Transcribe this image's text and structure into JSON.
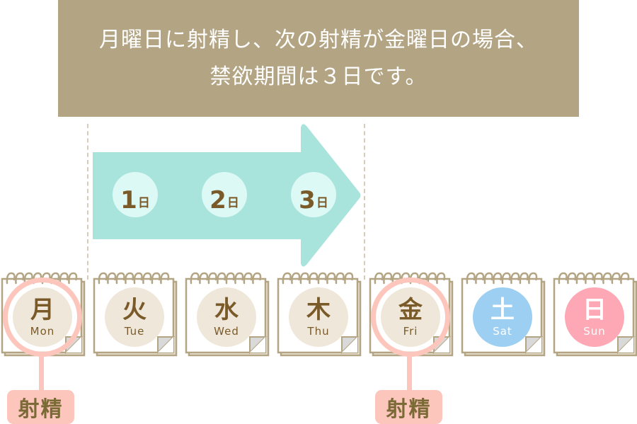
{
  "banner": {
    "line1": "月曜日に射精し、次の射精が金曜日の場合、",
    "line2": "禁欲期間は３日です。"
  },
  "arrow": {
    "direction": "right",
    "icon": "right-arrow-icon",
    "steps": [
      {
        "num": "1",
        "unit": "日"
      },
      {
        "num": "2",
        "unit": "日"
      },
      {
        "num": "3",
        "unit": "日"
      }
    ]
  },
  "days": [
    {
      "kanji": "月",
      "en": "Mon",
      "type": "weekday",
      "event": true
    },
    {
      "kanji": "火",
      "en": "Tue",
      "type": "weekday",
      "event": false
    },
    {
      "kanji": "水",
      "en": "Wed",
      "type": "weekday",
      "event": false
    },
    {
      "kanji": "木",
      "en": "Thu",
      "type": "weekday",
      "event": false
    },
    {
      "kanji": "金",
      "en": "Fri",
      "type": "weekday",
      "event": true
    },
    {
      "kanji": "土",
      "en": "Sat",
      "type": "saturday",
      "event": false
    },
    {
      "kanji": "日",
      "en": "Sun",
      "type": "sunday",
      "event": false
    }
  ],
  "events": [
    {
      "day": "Mon",
      "label": "射精"
    },
    {
      "day": "Fri",
      "label": "射精"
    }
  ],
  "colors": {
    "banner": "#b3a584",
    "arrow": "#a8e3dc",
    "step_circle": "#dcf9f5",
    "text_brown": "#7a5a28",
    "weekday_circle": "#efe8da",
    "saturday_circle": "#9ccff2",
    "sunday_circle": "#fea8b5",
    "event_pink": "#fdc6bd",
    "calendar_frame": "#b3a584"
  }
}
